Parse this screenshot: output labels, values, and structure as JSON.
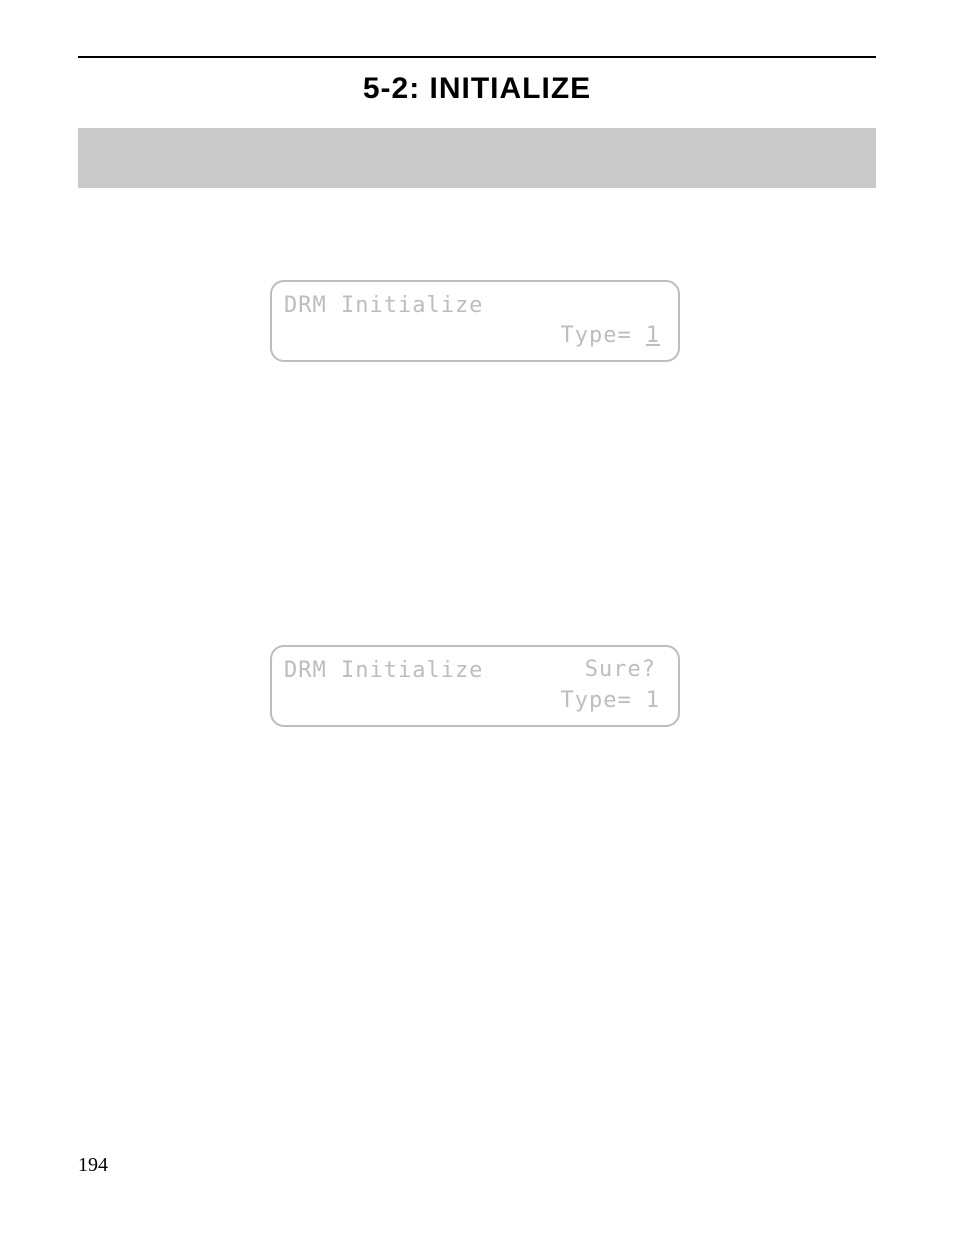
{
  "title": "5-2: INITIALIZE",
  "lcd1": {
    "line1": "DRM Initialize",
    "line2_label": "Type=",
    "line2_value": "1"
  },
  "lcd2": {
    "line1": "DRM Initialize",
    "sure": "Sure?",
    "line2_label": "Type=",
    "line2_value": "1"
  },
  "page_number": "194"
}
